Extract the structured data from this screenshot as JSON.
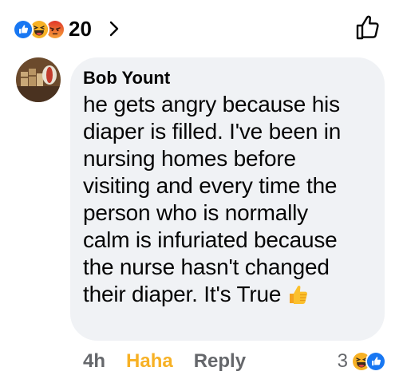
{
  "summary": {
    "count": "20",
    "reaction_icons": [
      "like-icon",
      "haha-icon",
      "angry-icon"
    ]
  },
  "comment": {
    "author": "Bob Yount",
    "text": "he gets angry because his\ndiaper is filled.  I've been in\nnursing homes before\nvisiting and every time the\nperson who is normally\ncalm is infuriated because\nthe nurse hasn't changed\ntheir diaper.  It's True",
    "trailing_emoji": "thumbs-up-emoji"
  },
  "actions": {
    "time": "4h",
    "reaction_label": "Haha",
    "reply_label": "Reply"
  },
  "comment_reactions": {
    "count": "3",
    "icons": [
      "haha-icon",
      "like-icon"
    ]
  },
  "colors": {
    "like_blue": "#1877f2",
    "haha_yellow": "#f7b125",
    "angry_orange": "#e9710f",
    "bubble_bg": "#f0f2f5",
    "secondary_text": "#65676b"
  }
}
